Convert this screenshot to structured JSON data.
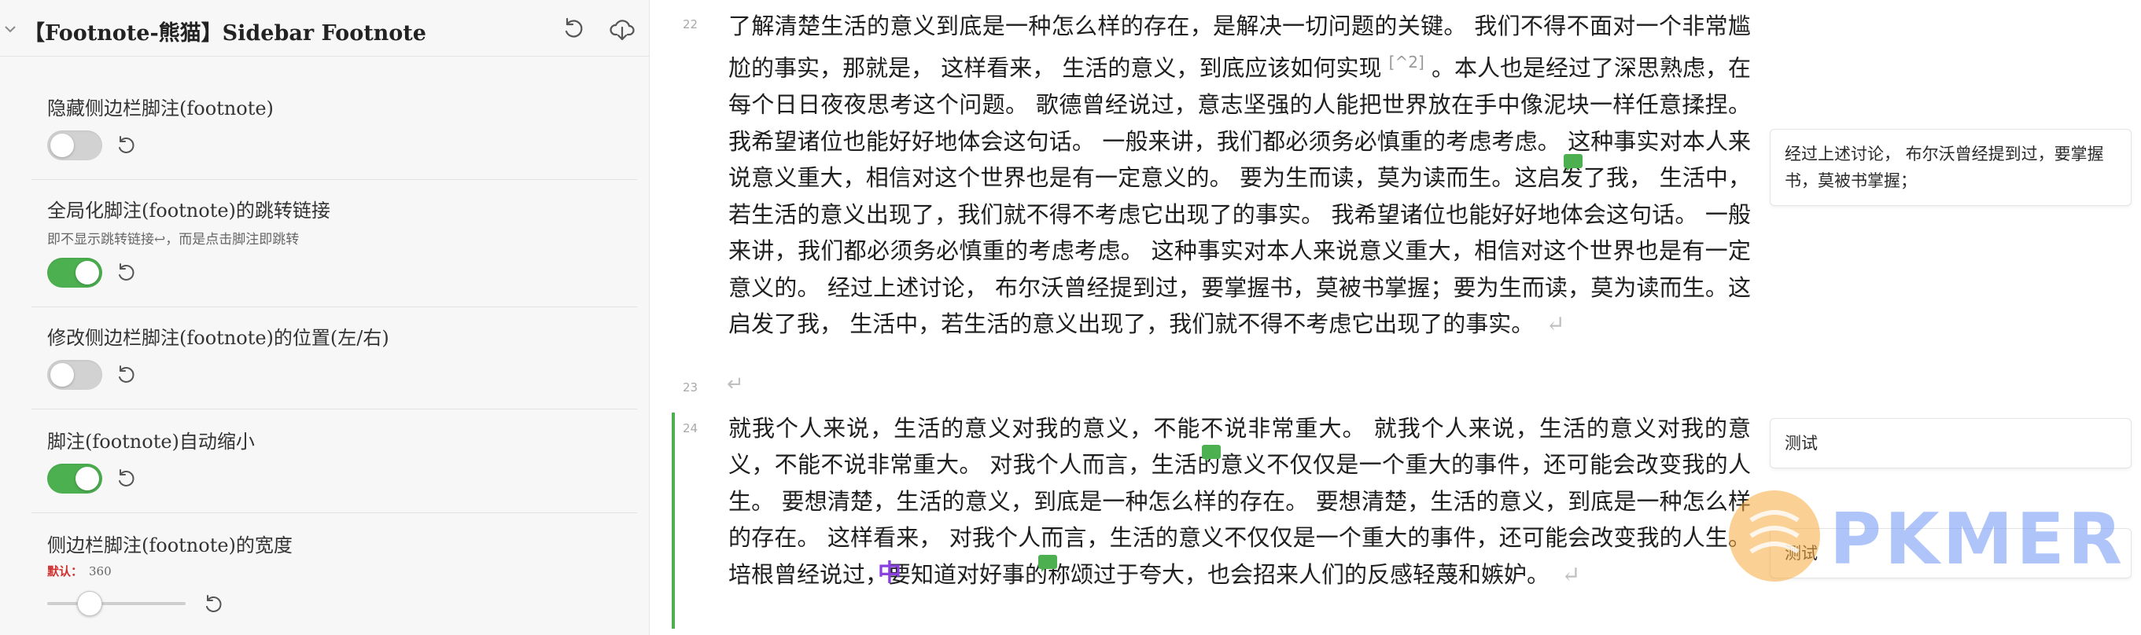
{
  "settings_panel": {
    "title": "【Footnote-熊猫】Sidebar Footnote",
    "items": [
      {
        "name": "隐藏侧边栏脚注(footnote)",
        "toggle": "off"
      },
      {
        "name": "全局化脚注(footnote)的跳转链接",
        "description": "即不显示跳转链接↩，而是点击脚注即跳转",
        "toggle": "on"
      },
      {
        "name": "修改侧边栏脚注(footnote)的位置(左/右)",
        "toggle": "off"
      },
      {
        "name": "脚注(footnote)自动缩小",
        "toggle": "on"
      },
      {
        "name": "侧边栏脚注(footnote)的宽度",
        "default_label": "默认：",
        "default_value": "360",
        "slider_fraction": 0.3
      }
    ]
  },
  "editor": {
    "lines": [
      {
        "number": "22",
        "text": "了解清楚生活的意义到底是一种怎么样的存在，是解决一切问题的关键。 我们不得不面对一个非常尴尬的事实，那就是， 这样看来， 生活的意义，到底应该如何实现 "
      },
      {
        "number": "23",
        "text": ""
      },
      {
        "number": "24",
        "text": "就我个人来说，生活的意义对我的意义，不能不说非常重大。 就我个人来说，生活的意义对我的意义，不能不说非常重大。 对我个人而言，生活的意义不仅仅是一个重大的事件，还可能会改变我的人生。 要想清楚，生活的意义，到底是一种怎么样的存在。 要想清楚，生活的意义，到底是一种怎么样的存在。 这样看来， 对我个人而言，生活的意义不仅仅是一个重大的事件，还可能会改变我的人生。 培根曾经说过，要知道对好事的称颂过于夸大，也会招来人们的反感轻蔑和嫉妒。"
      }
    ],
    "line22_part1": "了解清楚生活的意义到底是一种怎么样的存在，是解决一切问题的关键。 我们不得不面对一个非常尴尬的事实，那就是， 这样看来， 生活的意义，到底应该如何实现",
    "footnote_ref": "[^2]",
    "line22_part2": "。本人也是经过了深思熟虑，在每个日日夜夜思考这个问题。 歌德曾经说过，意志坚强的人能把世界放在手中像泥块一样任意揉捏。我希望诸位也能好好地体会这句话。 一般来讲，我们都必须务必慎重的考虑考虑。 这种事实对本人来说意义重大，相信对这个世界也是有一定意义的。 要为生而读，莫为读而生。这启发了我， 生活中，若生活的意义出现了，我们就不得不考虑它出现了的事实。 我希望诸位也能好好地体会这句话。 一般来讲，我们都必须务必慎重的考虑考虑。 这种事实对本人来说意义重大，相信对这个世界也是有一定意义的。 经过上述讨论， 布尔沃曾经提到过，要掌握书，莫被书掌握；要为生而读，莫为读而生。这启发了我， 生活中，若生活的意义出现了，我们就不得不考虑它出现了的事实。",
    "return_glyph": "↵",
    "cursor_glyph": "中"
  },
  "footnotes": [
    {
      "text": "经过上述讨论， 布尔沃曾经提到过，要掌握书，莫被书掌握；"
    },
    {
      "text": "测试"
    },
    {
      "text": "测试"
    }
  ],
  "watermark": {
    "text": "PKMER"
  },
  "colors": {
    "accent_green": "#4caf50",
    "toggle_off": "#d2d2d2",
    "default_label_red": "#d03030"
  }
}
